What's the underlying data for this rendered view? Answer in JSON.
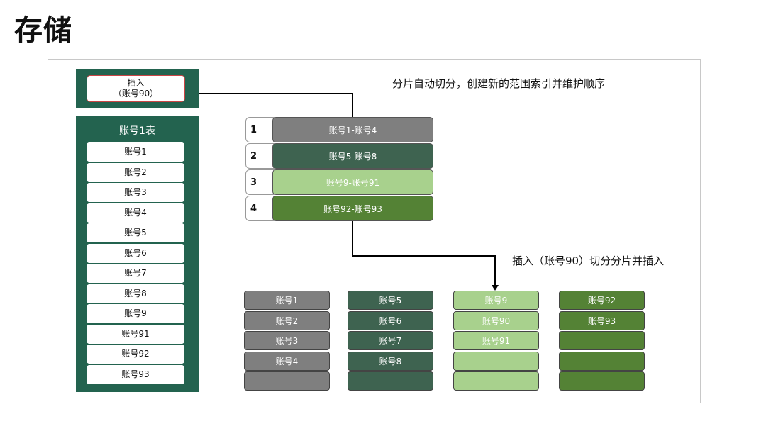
{
  "title": "存储",
  "insert_label_line1": "插入",
  "insert_label_line2": "（账号90）",
  "table_title": "账号1表",
  "accounts": [
    "账号1",
    "账号2",
    "账号3",
    "账号4",
    "账号5",
    "账号6",
    "账号7",
    "账号8",
    "账号9",
    "账号91",
    "账号92",
    "账号93"
  ],
  "caption_split": "分片自动切分，创建新的范围索引并维护顺序",
  "caption_insert": "插入（账号90）切分分片并插入",
  "ranges": [
    {
      "num": "1",
      "label": "账号1-账号4",
      "color": "#7f7f7f"
    },
    {
      "num": "2",
      "label": "账号5-账号8",
      "color": "#3e6350"
    },
    {
      "num": "3",
      "label": "账号9-账号91",
      "color": "#a8d18d"
    },
    {
      "num": "4",
      "label": "账号92-账号93",
      "color": "#548235"
    }
  ],
  "shards": [
    {
      "color": "#7f7f7f",
      "items": [
        "账号1",
        "账号2",
        "账号3",
        "账号4",
        ""
      ]
    },
    {
      "color": "#3e6350",
      "items": [
        "账号5",
        "账号6",
        "账号7",
        "账号8",
        ""
      ]
    },
    {
      "color": "#a8d18d",
      "items": [
        "账号9",
        "账号90",
        "账号91",
        "",
        ""
      ]
    },
    {
      "color": "#548235",
      "items": [
        "账号92",
        "账号93",
        "",
        "",
        ""
      ]
    }
  ]
}
